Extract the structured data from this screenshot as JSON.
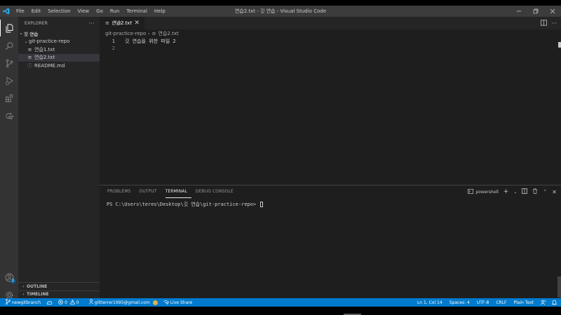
{
  "window": {
    "title": "연습2.txt - 깃 연습 - Visual Studio Code",
    "menu": [
      "File",
      "Edit",
      "Selection",
      "View",
      "Go",
      "Run",
      "Terminal",
      "Help"
    ]
  },
  "activity_bar": {
    "icons": [
      "explorer-icon",
      "search-icon",
      "source-control-icon",
      "run-debug-icon",
      "extensions-icon",
      "live-share-icon",
      "account-icon",
      "settings-gear-icon"
    ],
    "account_badge": "1"
  },
  "sidebar": {
    "header": "EXPLORER",
    "more_label": "···",
    "workspace": "깃 연습",
    "tree": [
      {
        "label": "git-practice-repo",
        "type": "folder",
        "depth": 1
      },
      {
        "label": "연습1.txt",
        "type": "file",
        "depth": 2
      },
      {
        "label": "연습2.txt",
        "type": "file",
        "depth": 2,
        "selected": true
      },
      {
        "label": "README.md",
        "type": "info-file",
        "depth": 2
      }
    ],
    "outline": "OUTLINE",
    "timeline": "TIMELINE"
  },
  "editor": {
    "tab": {
      "label": "연습2.txt"
    },
    "breadcrumb": [
      "git-practice-repo",
      "연습2.txt"
    ],
    "lines": [
      {
        "number": "1",
        "text": "깃 연습을 위한 파일 2"
      },
      {
        "number": "2",
        "text": ""
      }
    ]
  },
  "panel": {
    "tabs": [
      "PROBLEMS",
      "OUTPUT",
      "TERMINAL",
      "DEBUG CONSOLE"
    ],
    "active_tab": "TERMINAL",
    "shell": "powershell",
    "prompt": "PS C:\\Users\\teres\\Desktop\\깃 연습\\git-practice-repo> "
  },
  "status_bar": {
    "branch": "newgitbranch",
    "errors": "0",
    "warnings": "0",
    "account": "glitterrer1995@gmail.com",
    "live_share": "Live Share",
    "position": "Ln 1, Col 14",
    "spaces": "Spaces: 4",
    "encoding": "UTF-8",
    "eol": "CRLF",
    "language": "Plain Text"
  },
  "colors": {
    "accent": "#007acc",
    "titlebar": "#3c3c3c",
    "activitybar": "#333333",
    "sidebar": "#252526",
    "editor": "#1e1e1e"
  }
}
